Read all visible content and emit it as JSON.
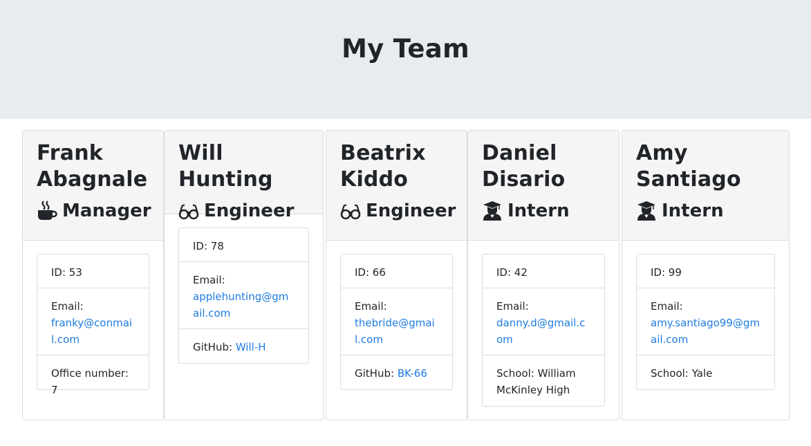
{
  "header": {
    "title": "My Team"
  },
  "employees": [
    {
      "name": "Frank Abagnale",
      "role": "Manager",
      "icon": "coffee-icon",
      "id_label": "ID: 53",
      "email_label": "Email:",
      "email": "franky@conmail.com",
      "extra_label": "Office number: 7",
      "extra_link": ""
    },
    {
      "name": "Will Hunting",
      "role": "Engineer",
      "icon": "glasses-icon",
      "id_label": "ID: 78",
      "email_label": "Email:",
      "email": "applehunting@gmail.com",
      "extra_label": "GitHub: ",
      "extra_link": "Will-H"
    },
    {
      "name": "Beatrix Kiddo",
      "role": "Engineer",
      "icon": "glasses-icon",
      "id_label": "ID: 66",
      "email_label": "Email:",
      "email": "thebride@gmail.com",
      "extra_label": "GitHub: ",
      "extra_link": "BK-66"
    },
    {
      "name": "Daniel Disario",
      "role": "Intern",
      "icon": "graduate-icon",
      "id_label": "ID: 42",
      "email_label": "Email:",
      "email": "danny.d@gmail.com",
      "extra_label": "School: William McKinley High",
      "extra_link": ""
    },
    {
      "name": "Amy Santiago",
      "role": "Intern",
      "icon": "graduate-icon",
      "id_label": "ID: 99",
      "email_label": "Email:",
      "email": "amy.santiago99@gmail.com",
      "extra_label": "School: Yale",
      "extra_link": ""
    }
  ],
  "colors": {
    "jumbotron_bg": "#e9ecef",
    "link": "#1e7be0",
    "card_header_bg": "#f5f5f5"
  }
}
